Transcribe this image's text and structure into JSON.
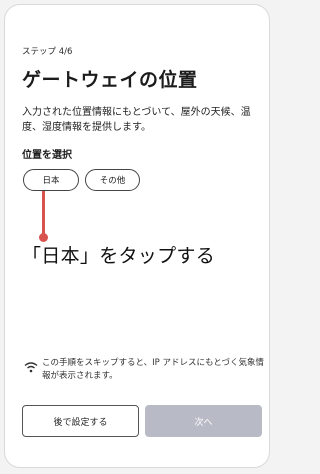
{
  "step": "ステップ 4/6",
  "title": "ゲートウェイの位置",
  "description": "入力された位置情報にもとづいて、屋外の天候、温度、湿度情報を提供します。",
  "section_label": "位置を選択",
  "options": [
    "日本",
    "その他"
  ],
  "annotation": {
    "instruction": "「日本」をタップする",
    "color": "#d9534f"
  },
  "notice": {
    "icon": "wifi-icon",
    "text": "この手順をスキップすると、IP アドレスにもとづく気象情報が表示されます。"
  },
  "buttons": {
    "later": "後で設定する",
    "next": "次へ"
  }
}
